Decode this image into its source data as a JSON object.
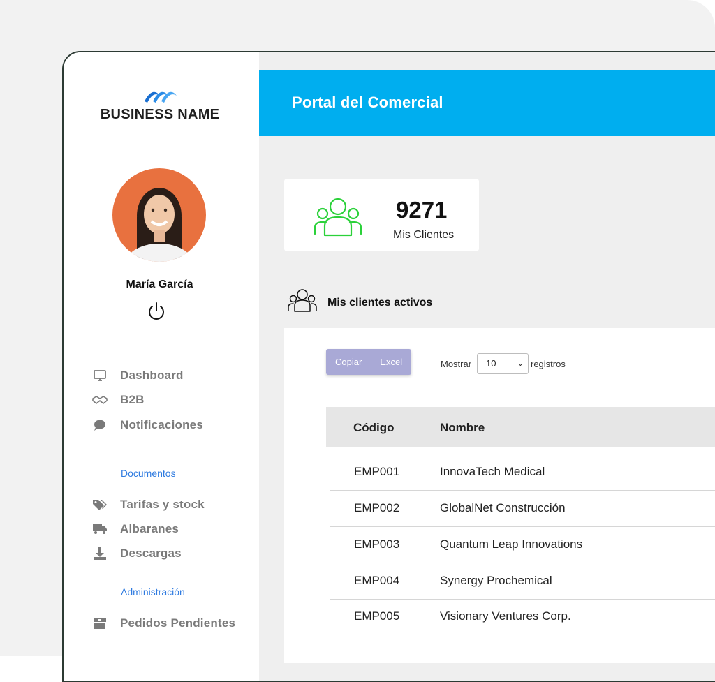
{
  "brand": {
    "name": "BUSINESS NAME"
  },
  "user": {
    "name": "María García"
  },
  "nav": {
    "items": [
      {
        "label": "Dashboard",
        "icon": "monitor-icon"
      },
      {
        "label": "B2B",
        "icon": "handshake-icon"
      },
      {
        "label": "Notificaciones",
        "icon": "chat-bubble-icon"
      }
    ],
    "documents_label": "Documentos",
    "documents_items": [
      {
        "label": "Tarifas y stock",
        "icon": "tags-icon"
      },
      {
        "label": "Albaranes",
        "icon": "truck-icon"
      },
      {
        "label": "Descargas",
        "icon": "download-icon"
      }
    ],
    "admin_label": "Administración",
    "admin_items": [
      {
        "label": "Pedidos Pendientes",
        "icon": "box-icon"
      }
    ]
  },
  "header": {
    "title": "Portal del Comercial"
  },
  "stats": {
    "value": "9271",
    "label": "Mis Clientes"
  },
  "section": {
    "title": "Mis clientes activos"
  },
  "toolbar": {
    "copy_label": "Copiar",
    "excel_label": "Excel",
    "show_label": "Mostrar",
    "show_value": "10",
    "records_label": "registros"
  },
  "table": {
    "columns": [
      "Código",
      "Nombre"
    ],
    "rows": [
      [
        "EMP001",
        "InnovaTech Medical"
      ],
      [
        "EMP002",
        "GlobalNet Construcción"
      ],
      [
        "EMP003",
        "Quantum Leap Innovations"
      ],
      [
        "EMP004",
        "Synergy Prochemical"
      ],
      [
        "EMP005",
        "Visionary Ventures Corp."
      ]
    ]
  },
  "colors": {
    "accent": "#00aeef",
    "stat_icon": "#2bd13a",
    "link": "#2f7be0",
    "button": "#a9a9d6"
  }
}
